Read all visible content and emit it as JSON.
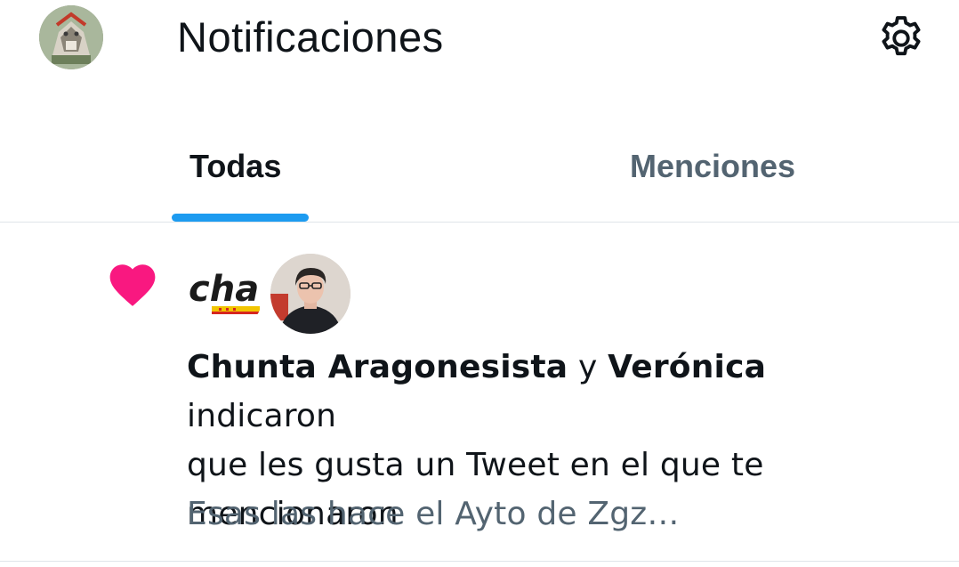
{
  "header": {
    "title": "Notificaciones",
    "avatar": "profile-avatar",
    "settings_icon": "gear-icon"
  },
  "tabs": [
    {
      "label": "Todas",
      "active": true
    },
    {
      "label": "Menciones",
      "active": false
    }
  ],
  "colors": {
    "accent": "#1d9bf0",
    "like": "#f91880",
    "primary_text": "#0f1419",
    "secondary_text": "#536471",
    "divider": "#dfe5e9"
  },
  "notification": {
    "type_icon": "heart-icon",
    "actor1": "Chunta Aragonesista",
    "conjunction": "y",
    "actor2": "Verónica",
    "action_part1": "indicaron",
    "action_part2": "que les gusta un Tweet en el que te",
    "action_part3": "mencionaron",
    "preview": "Esas las hace el Ayto de Zgz…",
    "avatar1_logo_text": "cha",
    "avatar2": "veronica-avatar"
  }
}
